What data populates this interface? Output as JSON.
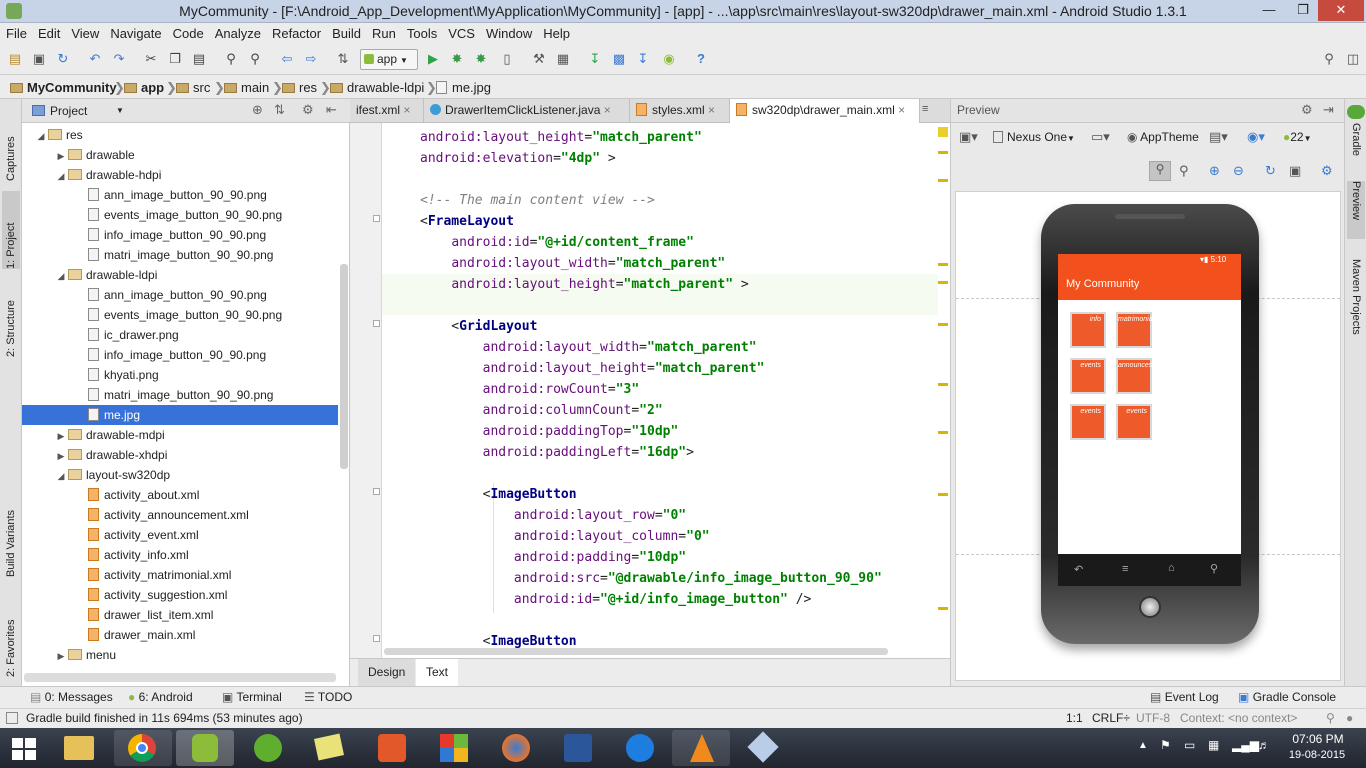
{
  "window": {
    "title": "MyCommunity - [F:\\Android_App_Development\\MyApplication\\MyCommunity] - [app] - ...\\app\\src\\main\\res\\layout-sw320dp\\drawer_main.xml - Android Studio 1.3.1",
    "min": "—",
    "max": "❐",
    "close": "✕"
  },
  "menu": [
    "File",
    "Edit",
    "View",
    "Navigate",
    "Code",
    "Analyze",
    "Refactor",
    "Build",
    "Run",
    "Tools",
    "VCS",
    "Window",
    "Help"
  ],
  "toolbar": {
    "run_config": "app"
  },
  "breadcrumb": [
    "MyCommunity",
    "app",
    "src",
    "main",
    "res",
    "drawable-ldpi",
    "me.jpg"
  ],
  "left_strip": {
    "captures": "Captures",
    "project": "1: Project",
    "structure": "2: Structure",
    "build_variants": "Build Variants",
    "favorites": "2: Favorites"
  },
  "project_panel": {
    "view": "Project",
    "tree": [
      {
        "label": "res",
        "kind": "dir",
        "depth": 0,
        "open": true
      },
      {
        "label": "drawable",
        "kind": "dir",
        "depth": 1,
        "open": false
      },
      {
        "label": "drawable-hdpi",
        "kind": "dir",
        "depth": 1,
        "open": true
      },
      {
        "label": "ann_image_button_90_90.png",
        "kind": "file",
        "depth": 2
      },
      {
        "label": "events_image_button_90_90.png",
        "kind": "file",
        "depth": 2
      },
      {
        "label": "info_image_button_90_90.png",
        "kind": "file",
        "depth": 2
      },
      {
        "label": "matri_image_button_90_90.png",
        "kind": "file",
        "depth": 2
      },
      {
        "label": "drawable-ldpi",
        "kind": "dir",
        "depth": 1,
        "open": true
      },
      {
        "label": "ann_image_button_90_90.png",
        "kind": "file",
        "depth": 2
      },
      {
        "label": "events_image_button_90_90.png",
        "kind": "file",
        "depth": 2
      },
      {
        "label": "ic_drawer.png",
        "kind": "file",
        "depth": 2
      },
      {
        "label": "info_image_button_90_90.png",
        "kind": "file",
        "depth": 2
      },
      {
        "label": "khyati.png",
        "kind": "file",
        "depth": 2
      },
      {
        "label": "matri_image_button_90_90.png",
        "kind": "file",
        "depth": 2
      },
      {
        "label": "me.jpg",
        "kind": "file",
        "depth": 2,
        "selected": true
      },
      {
        "label": "drawable-mdpi",
        "kind": "dir",
        "depth": 1,
        "open": false
      },
      {
        "label": "drawable-xhdpi",
        "kind": "dir",
        "depth": 1,
        "open": false
      },
      {
        "label": "layout-sw320dp",
        "kind": "dir",
        "depth": 1,
        "open": true
      },
      {
        "label": "activity_about.xml",
        "kind": "xml",
        "depth": 2
      },
      {
        "label": "activity_announcement.xml",
        "kind": "xml",
        "depth": 2
      },
      {
        "label": "activity_event.xml",
        "kind": "xml",
        "depth": 2
      },
      {
        "label": "activity_info.xml",
        "kind": "xml",
        "depth": 2
      },
      {
        "label": "activity_matrimonial.xml",
        "kind": "xml",
        "depth": 2
      },
      {
        "label": "activity_suggestion.xml",
        "kind": "xml",
        "depth": 2
      },
      {
        "label": "drawer_list_item.xml",
        "kind": "xml",
        "depth": 2
      },
      {
        "label": "drawer_main.xml",
        "kind": "xml",
        "depth": 2
      },
      {
        "label": "menu",
        "kind": "dir",
        "depth": 1,
        "open": false
      }
    ]
  },
  "editor_tabs": [
    {
      "label": "ifest.xml",
      "active": false
    },
    {
      "label": "DrawerItemClickListener.java",
      "active": false
    },
    {
      "label": "styles.xml",
      "active": false
    },
    {
      "label": "sw320dp\\drawer_main.xml",
      "active": true
    }
  ],
  "code_lines": [
    [
      {
        "c": "at",
        "t": "android:layout_height"
      },
      {
        "c": "",
        "t": "="
      },
      {
        "c": "st",
        "t": "\"match_parent\""
      }
    ],
    [
      {
        "c": "at",
        "t": "android:elevation"
      },
      {
        "c": "",
        "t": "="
      },
      {
        "c": "st",
        "t": "\"4dp\""
      },
      {
        "c": "",
        "t": " >"
      }
    ],
    [],
    [
      {
        "c": "cm",
        "t": "<!-- The main content view -->"
      }
    ],
    [
      {
        "c": "",
        "t": "<"
      },
      {
        "c": "tg",
        "t": "FrameLayout"
      }
    ],
    [
      {
        "c": "",
        "t": "    "
      },
      {
        "c": "at",
        "t": "android:id"
      },
      {
        "c": "",
        "t": "="
      },
      {
        "c": "st",
        "t": "\"@+id/content_frame\""
      }
    ],
    [
      {
        "c": "",
        "t": "    "
      },
      {
        "c": "at",
        "t": "android:layout_width"
      },
      {
        "c": "",
        "t": "="
      },
      {
        "c": "st",
        "t": "\"match_parent\""
      }
    ],
    [
      {
        "c": "",
        "t": "    "
      },
      {
        "c": "at",
        "t": "android:layout_height"
      },
      {
        "c": "",
        "t": "="
      },
      {
        "c": "st",
        "t": "\"match_parent\""
      },
      {
        "c": "",
        "t": " >"
      }
    ],
    [],
    [
      {
        "c": "",
        "t": "    <"
      },
      {
        "c": "tg",
        "t": "GridLayout"
      }
    ],
    [
      {
        "c": "",
        "t": "        "
      },
      {
        "c": "at",
        "t": "android:layout_width"
      },
      {
        "c": "",
        "t": "="
      },
      {
        "c": "st",
        "t": "\"match_parent\""
      }
    ],
    [
      {
        "c": "",
        "t": "        "
      },
      {
        "c": "at",
        "t": "android:layout_height"
      },
      {
        "c": "",
        "t": "="
      },
      {
        "c": "st",
        "t": "\"match_parent\""
      }
    ],
    [
      {
        "c": "",
        "t": "        "
      },
      {
        "c": "at",
        "t": "android:rowCount"
      },
      {
        "c": "",
        "t": "="
      },
      {
        "c": "st",
        "t": "\"3\""
      }
    ],
    [
      {
        "c": "",
        "t": "        "
      },
      {
        "c": "at",
        "t": "android:columnCount"
      },
      {
        "c": "",
        "t": "="
      },
      {
        "c": "st",
        "t": "\"2\""
      }
    ],
    [
      {
        "c": "",
        "t": "        "
      },
      {
        "c": "at",
        "t": "android:paddingTop"
      },
      {
        "c": "",
        "t": "="
      },
      {
        "c": "st",
        "t": "\"10dp\""
      }
    ],
    [
      {
        "c": "",
        "t": "        "
      },
      {
        "c": "at",
        "t": "android:paddingLeft"
      },
      {
        "c": "",
        "t": "="
      },
      {
        "c": "st",
        "t": "\"16dp\""
      },
      {
        "c": "",
        "t": ">"
      }
    ],
    [],
    [
      {
        "c": "",
        "t": "        <"
      },
      {
        "c": "tg",
        "t": "ImageButton"
      }
    ],
    [
      {
        "c": "",
        "t": "            "
      },
      {
        "c": "at",
        "t": "android:layout_row"
      },
      {
        "c": "",
        "t": "="
      },
      {
        "c": "st",
        "t": "\"0\""
      }
    ],
    [
      {
        "c": "",
        "t": "            "
      },
      {
        "c": "at",
        "t": "android:layout_column"
      },
      {
        "c": "",
        "t": "="
      },
      {
        "c": "st",
        "t": "\"0\""
      }
    ],
    [
      {
        "c": "",
        "t": "            "
      },
      {
        "c": "at",
        "t": "android:padding"
      },
      {
        "c": "",
        "t": "="
      },
      {
        "c": "st",
        "t": "\"10dp\""
      }
    ],
    [
      {
        "c": "",
        "t": "            "
      },
      {
        "c": "at",
        "t": "android:src"
      },
      {
        "c": "",
        "t": "="
      },
      {
        "c": "st",
        "t": "\"@drawable/info_image_button_90_90\""
      }
    ],
    [
      {
        "c": "",
        "t": "            "
      },
      {
        "c": "at",
        "t": "android:id"
      },
      {
        "c": "",
        "t": "="
      },
      {
        "c": "st",
        "t": "\"@+id/info_image_button\""
      },
      {
        "c": "",
        "t": " />"
      }
    ],
    [],
    [
      {
        "c": "",
        "t": "        <"
      },
      {
        "c": "tg",
        "t": "ImageButton"
      }
    ]
  ],
  "editor_bottom_tabs": {
    "design": "Design",
    "text": "Text"
  },
  "preview": {
    "title": "Preview",
    "device": "Nexus One",
    "theme": "AppTheme",
    "api": "22",
    "phone": {
      "time": "5:10",
      "app_title": "My Community",
      "buttons": [
        "info",
        "matrimonials",
        "events",
        "announces",
        "events",
        "events"
      ]
    }
  },
  "right_strip": {
    "gradle": "Gradle",
    "preview": "Preview",
    "maven": "Maven Projects"
  },
  "bottom_tools": {
    "messages": "0: Messages",
    "android": "6: Android",
    "terminal": "Terminal",
    "todo": "TODO",
    "event_log": "Event Log",
    "gradle_console": "Gradle Console"
  },
  "status": {
    "message": "Gradle build finished in 11s 694ms (53 minutes ago)",
    "position": "1:1",
    "line_sep": "CRLF÷",
    "encoding": "UTF-8",
    "context": "Context: <no context>"
  },
  "taskbar": {
    "time": "07:06 PM",
    "date": "19-08-2015"
  },
  "colors": {
    "selection": "#3872d8",
    "appbar": "#f2511d",
    "accent_button": "#ef5a2a"
  }
}
